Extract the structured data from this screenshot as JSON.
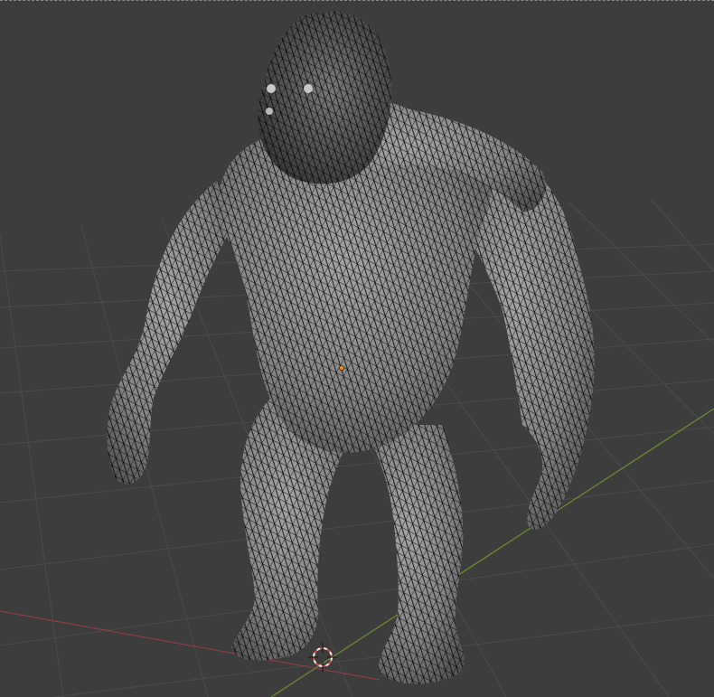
{
  "viewport": {
    "mode": "3D Viewport",
    "shading": "solid",
    "wireframe_overlay": true
  },
  "colors": {
    "background": "#3d3d3d",
    "grid_line": "#4a4a4a",
    "x_axis": "#8a3c44",
    "y_axis": "#6a8a2c",
    "mesh_fill": "#8c8c8c",
    "mesh_wire": "#0a0a0a",
    "origin": "#ff8a00",
    "cursor_red": "#d44a4a",
    "cursor_white": "#f0f0f0"
  },
  "object": {
    "name": "gorilla-mesh",
    "selected": false
  },
  "icons": {
    "cursor": "3d-cursor-icon",
    "origin": "object-origin-icon"
  }
}
